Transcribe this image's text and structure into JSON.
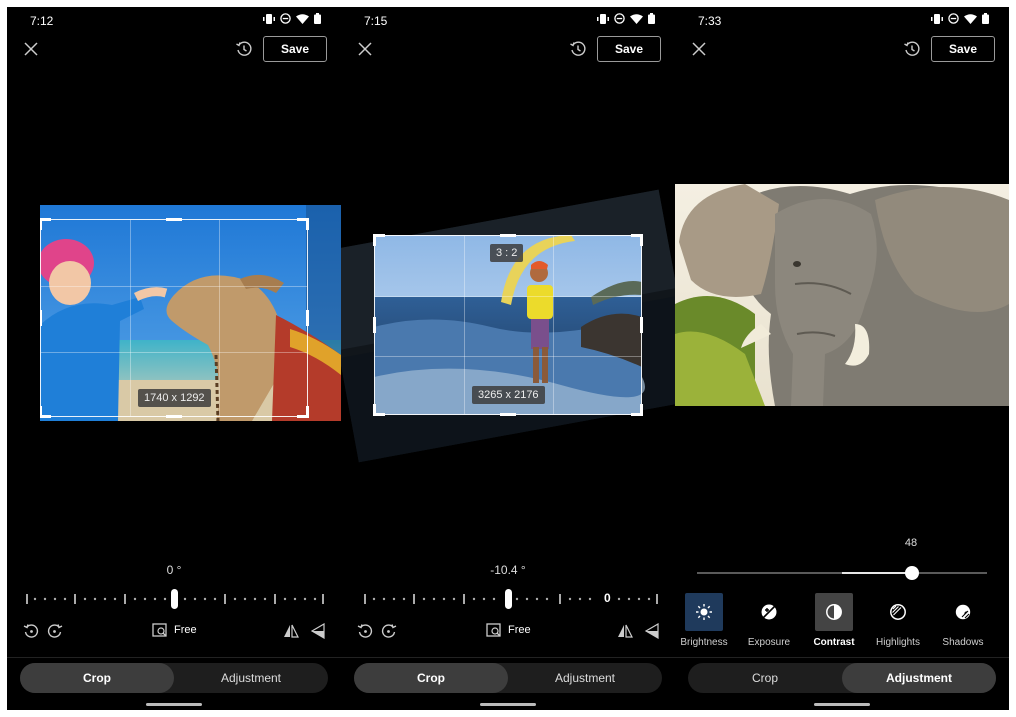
{
  "panels": [
    {
      "status": {
        "time": "7:12"
      },
      "save_label": "Save",
      "dimensions": "1740 x 1292",
      "angle": "0 °",
      "ratio_label": "Free",
      "tabs": [
        "Crop",
        "Adjustment"
      ],
      "active_tab": "Crop"
    },
    {
      "status": {
        "time": "7:15"
      },
      "save_label": "Save",
      "aspect_ratio": "3 : 2",
      "dimensions": "3265 x 2176",
      "angle": "-10.4 °",
      "ruler_zero": "0",
      "ratio_label": "Free",
      "tabs": [
        "Crop",
        "Adjustment"
      ],
      "active_tab": "Crop"
    },
    {
      "status": {
        "time": "7:33"
      },
      "save_label": "Save",
      "slider_value": "48",
      "slider_fraction": 0.74,
      "tools": [
        {
          "label": "Brightness",
          "icon": "brightness-icon"
        },
        {
          "label": "Exposure",
          "icon": "exposure-icon"
        },
        {
          "label": "Contrast",
          "icon": "contrast-icon"
        },
        {
          "label": "Highlights",
          "icon": "highlights-icon"
        },
        {
          "label": "Shadows",
          "icon": "shadows-icon"
        }
      ],
      "active_tool": "Contrast",
      "tabs": [
        "Crop",
        "Adjustment"
      ],
      "active_tab": "Adjustment"
    }
  ],
  "colors": {
    "background": "#000000",
    "active_tab": "#3d3d3d",
    "inactive_bar": "#1e1e1e",
    "brightness_highlight": "#1f3a5c",
    "contrast_highlight": "#444444"
  }
}
